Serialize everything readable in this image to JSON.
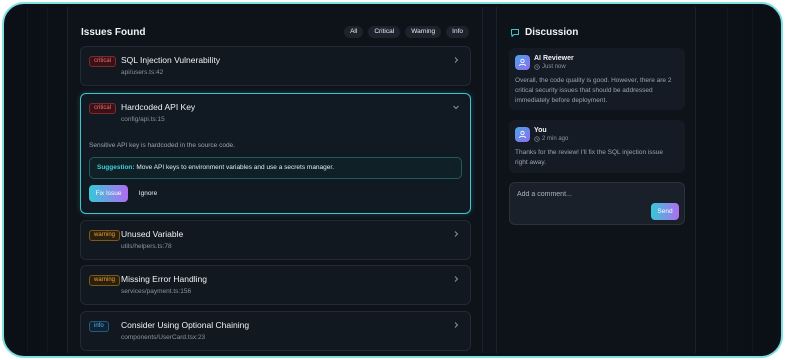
{
  "issues_panel": {
    "title": "Issues Found",
    "filters": [
      "All",
      "Critical",
      "Warning",
      "Info"
    ]
  },
  "issues": [
    {
      "severity": "critical",
      "title": "SQL Injection Vulnerability",
      "path": "api/users.ts:42"
    },
    {
      "severity": "critical",
      "title": "Hardcoded API Key",
      "path": "config/api.ts:15",
      "description": "Sensitive API key is hardcoded in the source code.",
      "suggestion_label": "Suggestion:",
      "suggestion_text": "Move API keys to environment variables and use a secrets manager.",
      "fix_label": "Fix Issue",
      "ignore_label": "Ignore"
    },
    {
      "severity": "warning",
      "title": "Unused Variable",
      "path": "utils/helpers.ts:78"
    },
    {
      "severity": "warning",
      "title": "Missing Error Handling",
      "path": "services/payment.ts:156"
    },
    {
      "severity": "info",
      "title": "Consider Using Optional Chaining",
      "path": "components/UserCard.tsx:23"
    }
  ],
  "discussion": {
    "title": "Discussion",
    "messages": [
      {
        "author": "AI Reviewer",
        "time": "Just now",
        "text": "Overall, the code quality is good. However, there are 2 critical security issues that should be addressed immediately before deployment."
      },
      {
        "author": "You",
        "time": "2 min ago",
        "text": "Thanks for the review! I'll fix the SQL injection issue right away."
      }
    ],
    "comment_placeholder": "Add a comment...",
    "send_label": "Send"
  },
  "colors": {
    "accent": "#3cc6cf",
    "gradient_end": "#b06df0",
    "critical": "#f06b6b",
    "warning": "#e8a33c",
    "info": "#56b4e9"
  }
}
